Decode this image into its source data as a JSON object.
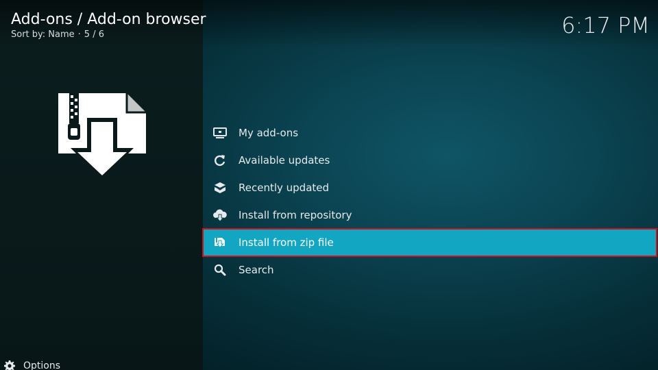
{
  "header": {
    "breadcrumb": "Add-ons / Add-on browser",
    "sort_label": "Sort by: Name",
    "separator": "·",
    "position": "5 / 6"
  },
  "clock": "6:17 PM",
  "preview": {
    "icon": "zip-file-download-icon"
  },
  "menu": {
    "selected_index": 4,
    "items": [
      {
        "label": "My add-ons",
        "icon": "monitor-box-icon"
      },
      {
        "label": "Available updates",
        "icon": "refresh-icon"
      },
      {
        "label": "Recently updated",
        "icon": "box-stack-icon"
      },
      {
        "label": "Install from repository",
        "icon": "cloud-download-icon"
      },
      {
        "label": "Install from zip file",
        "icon": "zip-file-icon"
      },
      {
        "label": "Search",
        "icon": "magnifier-icon"
      }
    ]
  },
  "footer": {
    "options_label": "Options",
    "icon": "gear-icon"
  },
  "colors": {
    "highlight": "#12a6c2",
    "highlight_border": "#d0101a",
    "background": "#0b4452",
    "left_panel": "#0a1a1b"
  }
}
